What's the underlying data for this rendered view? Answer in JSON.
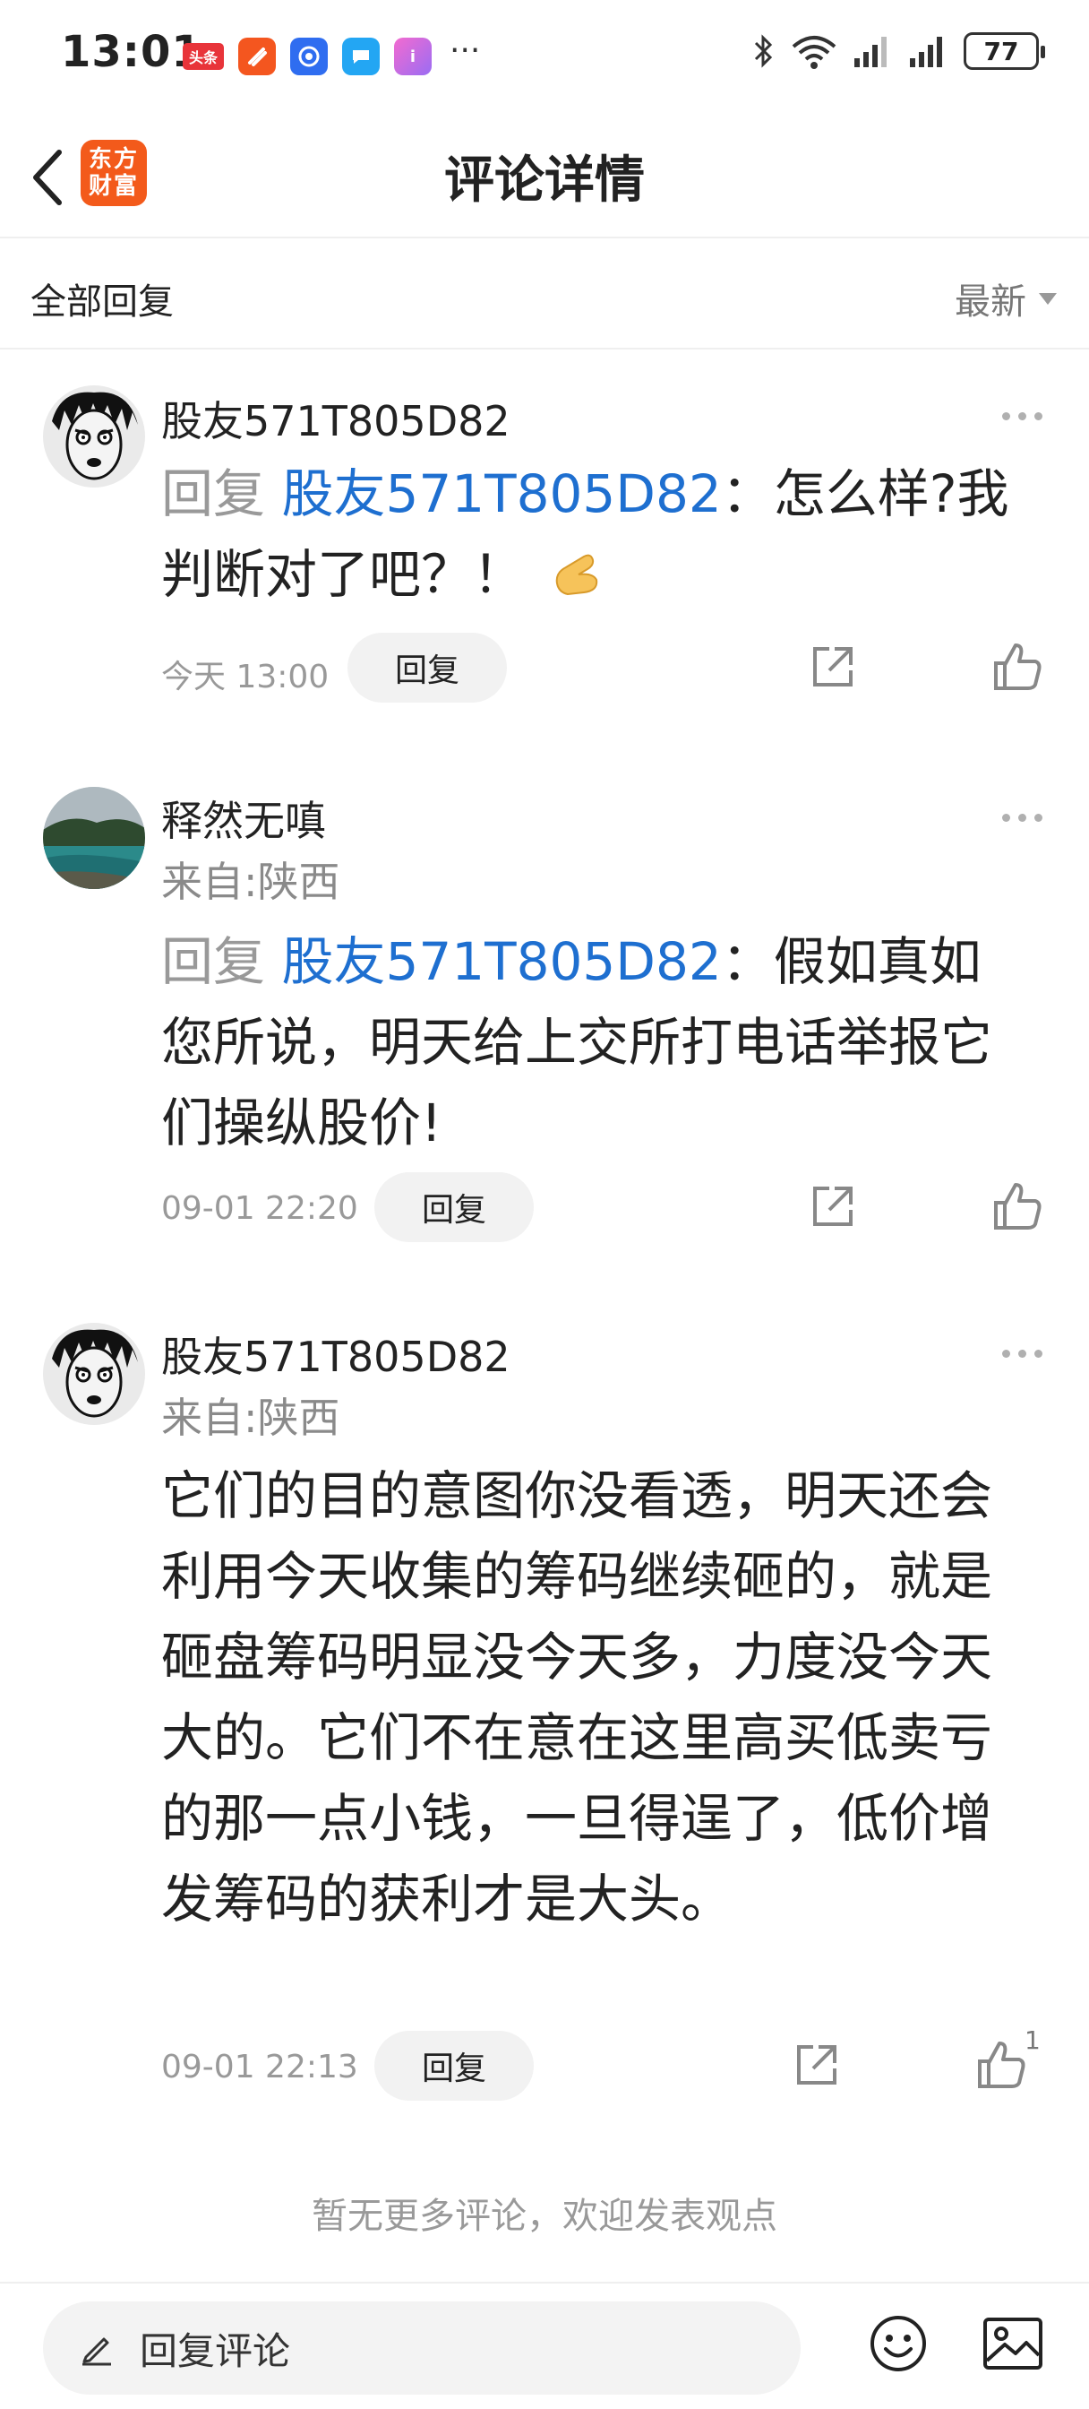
{
  "status_bar": {
    "time": "13:01",
    "app_icons": [
      "头条",
      "",
      "",
      "",
      "i"
    ],
    "more": "···",
    "battery": "77"
  },
  "header": {
    "logo_line1": "东方",
    "logo_line2": "财富",
    "title": "评论详情"
  },
  "sort_bar": {
    "all_replies": "全部回复",
    "sort_label": "最新"
  },
  "comments": [
    {
      "username": "股友571T805D82",
      "location": "",
      "reply_prefix": "回复",
      "mention": "股友571T805D82",
      "content": "：怎么样?我判断对了吧？！",
      "timestamp": "今天 13:00",
      "reply_label": "回复",
      "likes": ""
    },
    {
      "username": "释然无嗔",
      "location": "来自:陕西",
      "reply_prefix": "回复",
      "mention": "股友571T805D82",
      "content": "：假如真如您所说，明天给上交所打电话举报它们操纵股价!",
      "timestamp": "09-01 22:20",
      "reply_label": "回复",
      "likes": ""
    },
    {
      "username": "股友571T805D82",
      "location": "来自:陕西",
      "reply_prefix": "",
      "mention": "",
      "content": "它们的目的意图你没看透，明天还会利用今天收集的筹码继续砸的，就是砸盘筹码明显没今天多，力度没今天大的。它们不在意在这里高买低卖亏的那一点小钱，一旦得逞了，低价增发筹码的获利才是大头。",
      "timestamp": "09-01 22:13",
      "reply_label": "回复",
      "likes": "1"
    }
  ],
  "footer": {
    "no_more": "暂无更多评论，欢迎发表观点",
    "reply_placeholder": "回复评论"
  },
  "colors": {
    "mention": "#1e6fd0",
    "logo_bg": "#f35a1b",
    "muted": "#999999"
  }
}
